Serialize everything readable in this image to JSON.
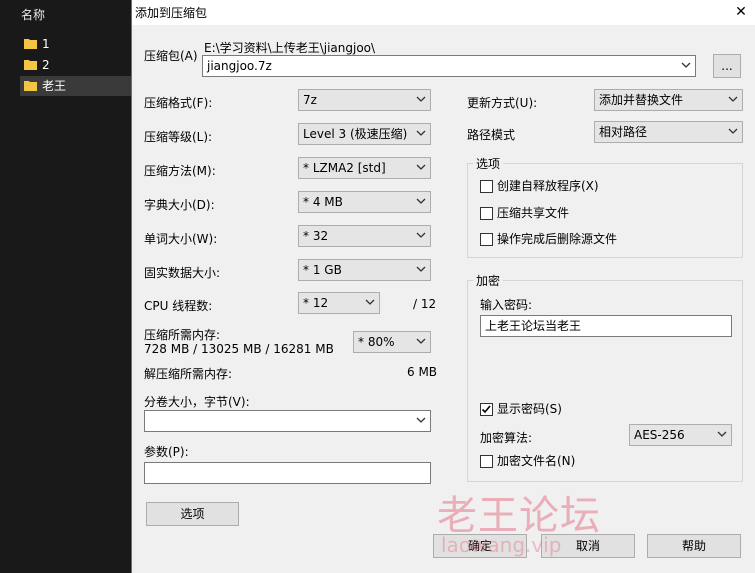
{
  "explorer": {
    "header": "名称",
    "items": [
      {
        "label": "1"
      },
      {
        "label": "2"
      },
      {
        "label": "老王"
      }
    ]
  },
  "dialog": {
    "title": "添加到压缩包",
    "archive": {
      "label": "压缩包(A)",
      "path": "E:\\学习资料\\上传老王\\jiangjoo\\",
      "value": "jiangjoo.7z",
      "browse_label": "..."
    },
    "left": {
      "format": {
        "label": "压缩格式(F):",
        "value": "7z"
      },
      "level": {
        "label": "压缩等级(L):",
        "value": "Level 3 (极速压缩)"
      },
      "method": {
        "label": "压缩方法(M):",
        "value": "* LZMA2 [std]"
      },
      "dict": {
        "label": "字典大小(D):",
        "value": "* 4 MB"
      },
      "word": {
        "label": "单词大小(W):",
        "value": "* 32"
      },
      "solid": {
        "label": "固实数据大小:",
        "value": "* 1 GB"
      },
      "threads": {
        "label": "CPU 线程数:",
        "value": "* 12",
        "max": "/ 12"
      },
      "mem_compress": {
        "label": "压缩所需内存:",
        "detail": "728 MB / 13025 MB / 16281 MB",
        "value": "* 80%"
      },
      "mem_decompress": {
        "label": "解压缩所需内存:",
        "value": "6 MB"
      },
      "volume": {
        "label": "分卷大小，字节(V):",
        "value": ""
      },
      "params": {
        "label": "参数(P):",
        "value": ""
      },
      "options_button": "选项"
    },
    "right": {
      "update": {
        "label": "更新方式(U):",
        "value": "添加并替换文件"
      },
      "path_mode": {
        "label": "路径模式",
        "value": "相对路径"
      },
      "options": {
        "title": "选项",
        "sfx": {
          "label": "创建自释放程序(X)",
          "checked": false
        },
        "shared": {
          "label": "压缩共享文件",
          "checked": false
        },
        "delete": {
          "label": "操作完成后删除源文件",
          "checked": false
        }
      },
      "encryption": {
        "title": "加密",
        "password_label": "输入密码:",
        "password_value": "上老王论坛当老王",
        "show_password": {
          "label": "显示密码(S)",
          "checked": true
        },
        "method_label": "加密算法:",
        "method_value": "AES-256",
        "encrypt_names": {
          "label": "加密文件名(N)",
          "checked": false
        }
      }
    },
    "buttons": {
      "ok": "确定",
      "cancel": "取消",
      "help": "帮助"
    }
  },
  "watermark": {
    "main": "老王论坛",
    "sub": "laowang.vip"
  },
  "colors": {
    "explorer_bg": "#191919",
    "dialog_bg": "#f0f0f0",
    "folder": "#f4c542"
  }
}
